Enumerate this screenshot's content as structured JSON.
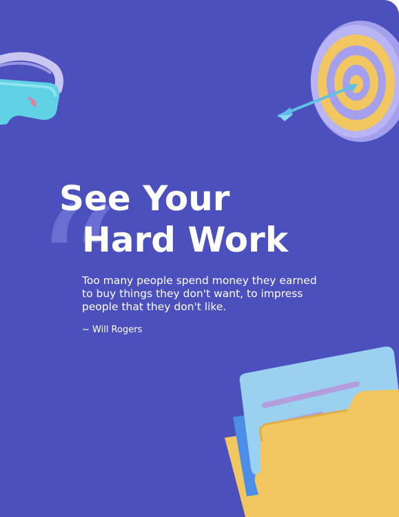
{
  "title": {
    "line1": "See Your",
    "line2": "Hard Work"
  },
  "quote": {
    "text": "Too many people spend money they earned to buy things they don't want, to impress people that they don't like."
  },
  "author": {
    "text": "~ Will Rogers"
  },
  "quote_mark": {
    "glyph": "“"
  },
  "colors": {
    "background": "#4b50bc",
    "quote_mark": "#6a70d4",
    "text": "#ffffff"
  },
  "illustrations": [
    "vr-headset-icon",
    "target-icon",
    "folder-icon"
  ]
}
